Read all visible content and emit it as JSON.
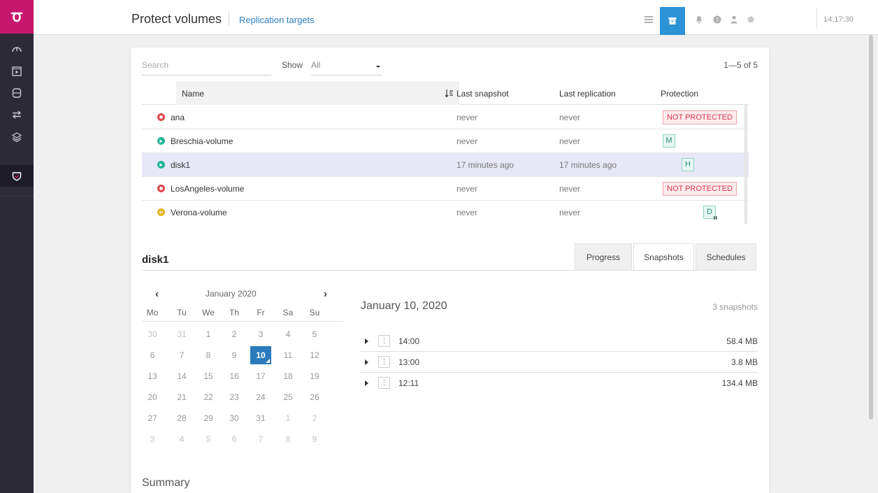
{
  "topbar": {
    "title": "Protect volumes",
    "link": "Replication targets",
    "clock": "14:17:30"
  },
  "toolbar": {
    "search_placeholder": "Search",
    "show_label": "Show",
    "show_value": "All",
    "pager": "1—5 of 5"
  },
  "table": {
    "headers": {
      "name": "Name",
      "last_snapshot": "Last snapshot",
      "last_replication": "Last replication",
      "protection": "Protection"
    },
    "rows": [
      {
        "status": "error",
        "name": "ana",
        "last_snapshot": "never",
        "last_replication": "never",
        "protection": "NOT PROTECTED"
      },
      {
        "status": "ok",
        "name": "Breschia-volume",
        "last_snapshot": "never",
        "last_replication": "never",
        "protection": "M"
      },
      {
        "status": "ok",
        "name": "disk1",
        "last_snapshot": "17 minutes ago",
        "last_replication": "17 minutes ago",
        "protection": "H"
      },
      {
        "status": "error",
        "name": "LosAngeles-volume",
        "last_snapshot": "never",
        "last_replication": "never",
        "protection": "NOT PROTECTED"
      },
      {
        "status": "paused",
        "name": "Verona-volume",
        "last_snapshot": "never",
        "last_replication": "never",
        "protection": "D"
      }
    ]
  },
  "detail": {
    "title": "disk1",
    "tabs": [
      "Progress",
      "Snapshots",
      "Schedules"
    ],
    "active_tab": "Snapshots"
  },
  "calendar": {
    "month": "January 2020",
    "weekdays": [
      "Mo",
      "Tu",
      "We",
      "Th",
      "Fr",
      "Sa",
      "Su"
    ],
    "weeks": [
      [
        "30",
        "31",
        "1",
        "2",
        "3",
        "4",
        "5"
      ],
      [
        "6",
        "7",
        "8",
        "9",
        "10",
        "11",
        "12"
      ],
      [
        "13",
        "14",
        "15",
        "16",
        "17",
        "18",
        "19"
      ],
      [
        "20",
        "21",
        "22",
        "23",
        "24",
        "25",
        "26"
      ],
      [
        "27",
        "28",
        "29",
        "30",
        "31",
        "1",
        "2"
      ],
      [
        "3",
        "4",
        "5",
        "6",
        "7",
        "8",
        "9"
      ]
    ],
    "selected_day": "10"
  },
  "snapshots": {
    "date": "January 10, 2020",
    "count": "3 snapshots",
    "items": [
      {
        "time": "14:00",
        "size": "58.4 MB"
      },
      {
        "time": "13:00",
        "size": "3.8 MB"
      },
      {
        "time": "12:11",
        "size": "134.4 MB"
      }
    ]
  },
  "summary_title": "Summary",
  "icons": {
    "rail": [
      "speedometer-icon",
      "play-icon",
      "database-icon",
      "transfer-icon",
      "layers-icon",
      "shield-check-icon"
    ],
    "topbar": [
      "list-icon",
      "archive-icon",
      "bell-icon",
      "help-icon",
      "user-icon",
      "gear-icon"
    ]
  },
  "colors": {
    "brand": "#c8176e",
    "accent": "#2b93d6",
    "error": "#e0444a",
    "ok": "#23b49a",
    "paused": "#e6b422"
  }
}
